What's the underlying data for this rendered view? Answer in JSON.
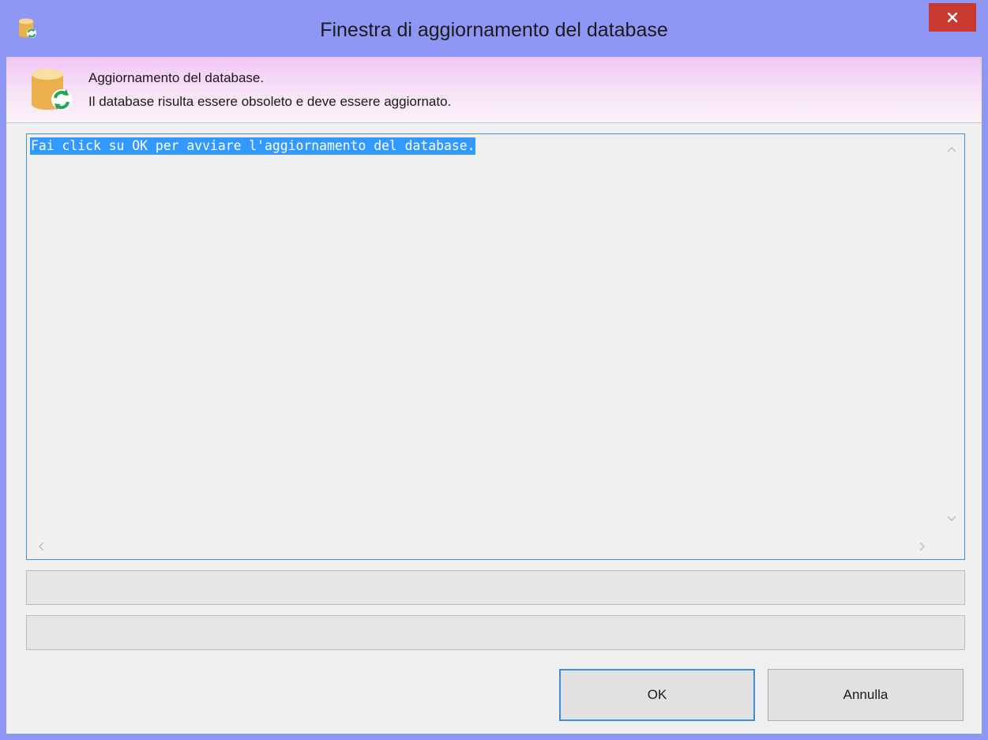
{
  "window": {
    "title": "Finestra di aggiornamento del database",
    "close_symbol": "✕",
    "app_icon": "database-refresh-icon"
  },
  "header": {
    "icon": "database-refresh-icon",
    "line1": "Aggiornamento del database.",
    "line2": "Il database risulta essere obsoleto e deve essere aggiornato."
  },
  "log": {
    "text": "Fai click su OK per avviare l'aggiornamento del database.",
    "selection_color": "#3399ff",
    "scroll_up": "^",
    "scroll_down": "v",
    "scroll_left": "<",
    "scroll_right": ">"
  },
  "progress_bars": [
    {
      "value": 0
    },
    {
      "value": 0
    }
  ],
  "buttons": {
    "ok_label": "OK",
    "cancel_label": "Annulla"
  },
  "colors": {
    "title_bar": "#8f97f5",
    "close_button": "#c8392f",
    "focus_border": "#3c8fd8"
  }
}
